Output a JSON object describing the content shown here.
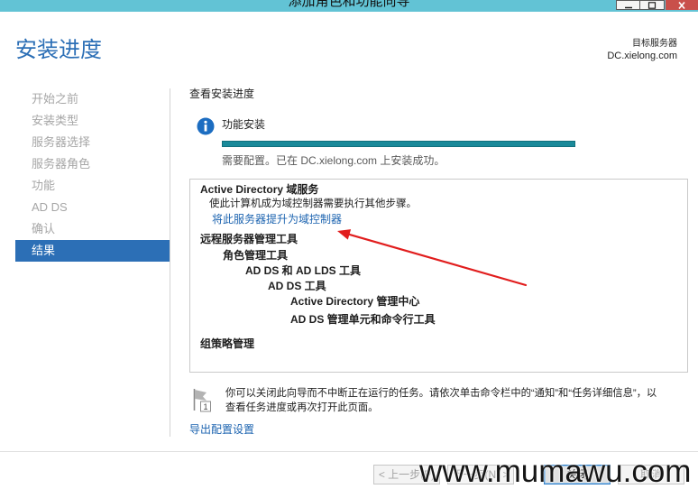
{
  "window": {
    "title": "添加角色和功能向导",
    "icons": {
      "minimize": "minimize-icon",
      "maximize": "maximize-icon",
      "close": "close-icon"
    }
  },
  "header": {
    "page_title": "安装进度",
    "target_server_label": "目标服务器",
    "target_server_name": "DC.xielong.com"
  },
  "nav": {
    "items": [
      {
        "label": "开始之前",
        "selected": false
      },
      {
        "label": "安装类型",
        "selected": false
      },
      {
        "label": "服务器选择",
        "selected": false
      },
      {
        "label": "服务器角色",
        "selected": false
      },
      {
        "label": "功能",
        "selected": false
      },
      {
        "label": "AD DS",
        "selected": false
      },
      {
        "label": "确认",
        "selected": false
      },
      {
        "label": "结果",
        "selected": true
      }
    ]
  },
  "main": {
    "section_label": "查看安装进度",
    "progress": {
      "icon": "info-icon",
      "title": "功能安装",
      "percent": 100,
      "status": "需要配置。已在 DC.xielong.com 上安装成功。"
    },
    "results": {
      "ad_ds": {
        "title": "Active Directory 域服务",
        "message": "使此计算机成为域控制器需要执行其他步骤。",
        "link": "将此服务器提升为域控制器"
      },
      "rsat": {
        "title": "远程服务器管理工具",
        "role_tools": {
          "title": "角色管理工具",
          "ad_tools": {
            "title": "AD DS 和 AD LDS 工具",
            "ad_ds_tools": {
              "title": "AD DS 工具",
              "items": [
                "Active Directory 管理中心",
                "AD DS 管理单元和命令行工具"
              ]
            }
          }
        }
      },
      "gpmc": {
        "title": "组策略管理"
      }
    },
    "note": {
      "icon": "flag-icon",
      "badge": "1",
      "lines": [
        "你可以关闭此向导而不中断正在运行的任务。请依次单击命令栏中的“通知”和“任务详细信息”，以",
        "查看任务进度或再次打开此页面。"
      ]
    },
    "export_link": "导出配置设置"
  },
  "footer": {
    "buttons": [
      {
        "label": "< 上一步(P)",
        "disabled": true,
        "default": false
      },
      {
        "label": "下一步(N) >",
        "disabled": true,
        "default": false
      },
      {
        "label": "关闭",
        "disabled": false,
        "default": true
      },
      {
        "label": "取消",
        "disabled": true,
        "default": false
      }
    ]
  },
  "watermark": "www.mumawu.com",
  "colors": {
    "title_bar": "#62c3d5",
    "accent": "#2c6fb6",
    "link": "#1d64b0",
    "progress": "#1a8a9a",
    "close_button": "#c9504b",
    "annotation": "#e11d1d"
  }
}
